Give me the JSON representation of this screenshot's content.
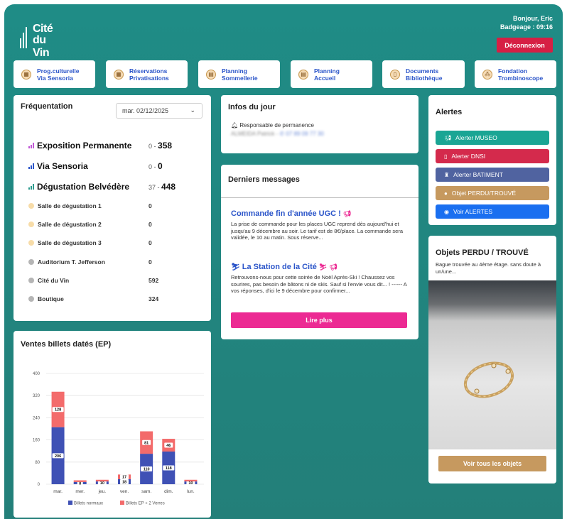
{
  "header": {
    "logo_line1": "Cité",
    "logo_line2": "du Vin",
    "greeting": "Bonjour, Eric",
    "badge": "Badgeage : 09:16",
    "logout_label": "Déconnexion"
  },
  "nav": [
    {
      "line1": "Prog.culturelle",
      "line2": "Via Sensoria",
      "icon": "calendar-icon"
    },
    {
      "line1": "Réservations",
      "line2": "Privatisations",
      "icon": "calendar-icon"
    },
    {
      "line1": "Planning",
      "line2": "Sommellerie",
      "icon": "clipboard-icon"
    },
    {
      "line1": "Planning",
      "line2": "Accueil",
      "icon": "clipboard-icon"
    },
    {
      "line1": "Documents",
      "line2": "Bibliothèque",
      "icon": "document-icon"
    },
    {
      "line1": "Fondation",
      "line2": "Trombinoscope",
      "icon": "people-icon"
    }
  ],
  "frequentation": {
    "title": "Fréquentation",
    "date": "mar. 02/12/2025",
    "main_rows": [
      {
        "label": "Exposition Permanente",
        "a": "0",
        "b": "358",
        "color": "#c056d6"
      },
      {
        "label": "Via Sensoria",
        "a": "0",
        "b": "0",
        "color": "#2b55c9"
      },
      {
        "label": "Dégustation Belvédère",
        "a": "37",
        "b": "448",
        "color": "#2c9b8e"
      }
    ],
    "rows": [
      {
        "label": "Salle de dégustation 1",
        "value": "0",
        "color": "#f7dca8"
      },
      {
        "label": "Salle de dégustation 2",
        "value": "0",
        "color": "#f7dca8"
      },
      {
        "label": "Salle de dégustation 3",
        "value": "0",
        "color": "#f7dca8"
      },
      {
        "label": "Auditorium T. Jefferson",
        "value": "0",
        "color": "#b5b5b5"
      },
      {
        "label": "Cité du Vin",
        "value": "592",
        "color": "#b5b5b5"
      },
      {
        "label": "Boutique",
        "value": "324",
        "color": "#b5b5b5"
      }
    ]
  },
  "infos": {
    "title": "Infos du jour",
    "perm_label": "Responsable de permanence",
    "perm_name": "ALMEIDA Patrick",
    "perm_phone": "07 89 09 77 30"
  },
  "messages": {
    "title": "Derniers messages",
    "items": [
      {
        "title": "Commande fin d'année UGC !",
        "body": "La prise de commande pour les places UGC reprend dès aujourd'hui et jusqu'au 9 décembre au soir. Le tarif est de 8€/place. La commande sera validée, le 10 au matin. Sous réserve..."
      },
      {
        "title": "La Station de la Cité",
        "body": "Retrouvons-nous pour cette soirée de Noël Après-Ski ! Chaussez vos sourires, pas besoin de bâtons ni de skis. Sauf si l'envie vous dit... ! ------ A vos réponses, d'ici le 9 décembre pour confirmer..."
      }
    ],
    "button": "Lire plus"
  },
  "alertes": {
    "title": "Alertes",
    "buttons": [
      {
        "label": "Alerter MUSEO",
        "color": "#1aa594",
        "icon": "megaphone-icon"
      },
      {
        "label": "Alerter DNSI",
        "color": "#d42a4c",
        "icon": "phone-icon"
      },
      {
        "label": "Alerter BATIMENT",
        "color": "#5063a0",
        "icon": "building-icon"
      },
      {
        "label": "Objet PERDU/TROUVÉ",
        "color": "#c6995f",
        "icon": "info-icon"
      },
      {
        "label": "Voir ALERTES",
        "color": "#1a6ff0",
        "icon": "eye-icon"
      }
    ]
  },
  "objets": {
    "title": "Objets PERDU / TROUVÉ",
    "desc": "Bague trouvée au 4ème étage. sans doute à un/une...",
    "button": "Voir tous les objets"
  },
  "chart_data": {
    "type": "bar",
    "title": "Ventes billets datés (EP)",
    "categories": [
      "mar.",
      "mer.",
      "jeu.",
      "ven.",
      "sam.",
      "dim.",
      "lun."
    ],
    "series": [
      {
        "name": "Billets normaux",
        "values": [
          206,
          8,
          10,
          18,
          110,
          118,
          10
        ],
        "color": "#3f51b5"
      },
      {
        "name": "Billets EP + 2 Verres",
        "values": [
          128,
          6,
          6,
          17,
          81,
          46,
          6
        ],
        "color": "#f36b6b"
      }
    ],
    "labels": [
      [
        "206",
        "128"
      ],
      [
        "8",
        ""
      ],
      [
        "10",
        ""
      ],
      [
        "18",
        "17"
      ],
      [
        "110",
        "81"
      ],
      [
        "118",
        "46"
      ],
      [
        "10",
        ""
      ]
    ],
    "yticks": [
      0,
      80,
      160,
      240,
      320,
      400
    ],
    "ylim": [
      0,
      400
    ],
    "stacked": true,
    "legend": "bottom"
  }
}
